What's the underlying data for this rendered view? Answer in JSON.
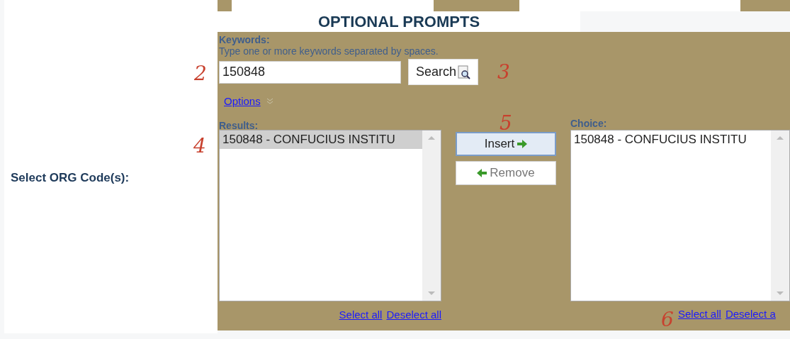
{
  "field_label": "Select ORG Code(s):",
  "section_title": "OPTIONAL PROMPTS",
  "keywords": {
    "label": "Keywords:",
    "hint": "Type one or more keywords separated by spaces.",
    "value": "150848",
    "button": "Search"
  },
  "options_link": "Options",
  "results": {
    "label": "Results:",
    "items": [
      {
        "text": "150848 - CONFUCIUS INSTITU",
        "selected": true
      }
    ],
    "select_all": "Select all",
    "deselect_all": "Deselect all"
  },
  "insert_button": {
    "label": "Insert",
    "focused": true
  },
  "remove_button": {
    "label": "Remove",
    "focused": false
  },
  "choice": {
    "label": "Choice:",
    "items": [
      {
        "text": "150848 - CONFUCIUS INSTITU",
        "selected": false
      }
    ],
    "select_all": "Select all",
    "deselect_all": "Deselect a"
  },
  "annotations": [
    "2",
    "3",
    "4",
    "5",
    "6"
  ]
}
